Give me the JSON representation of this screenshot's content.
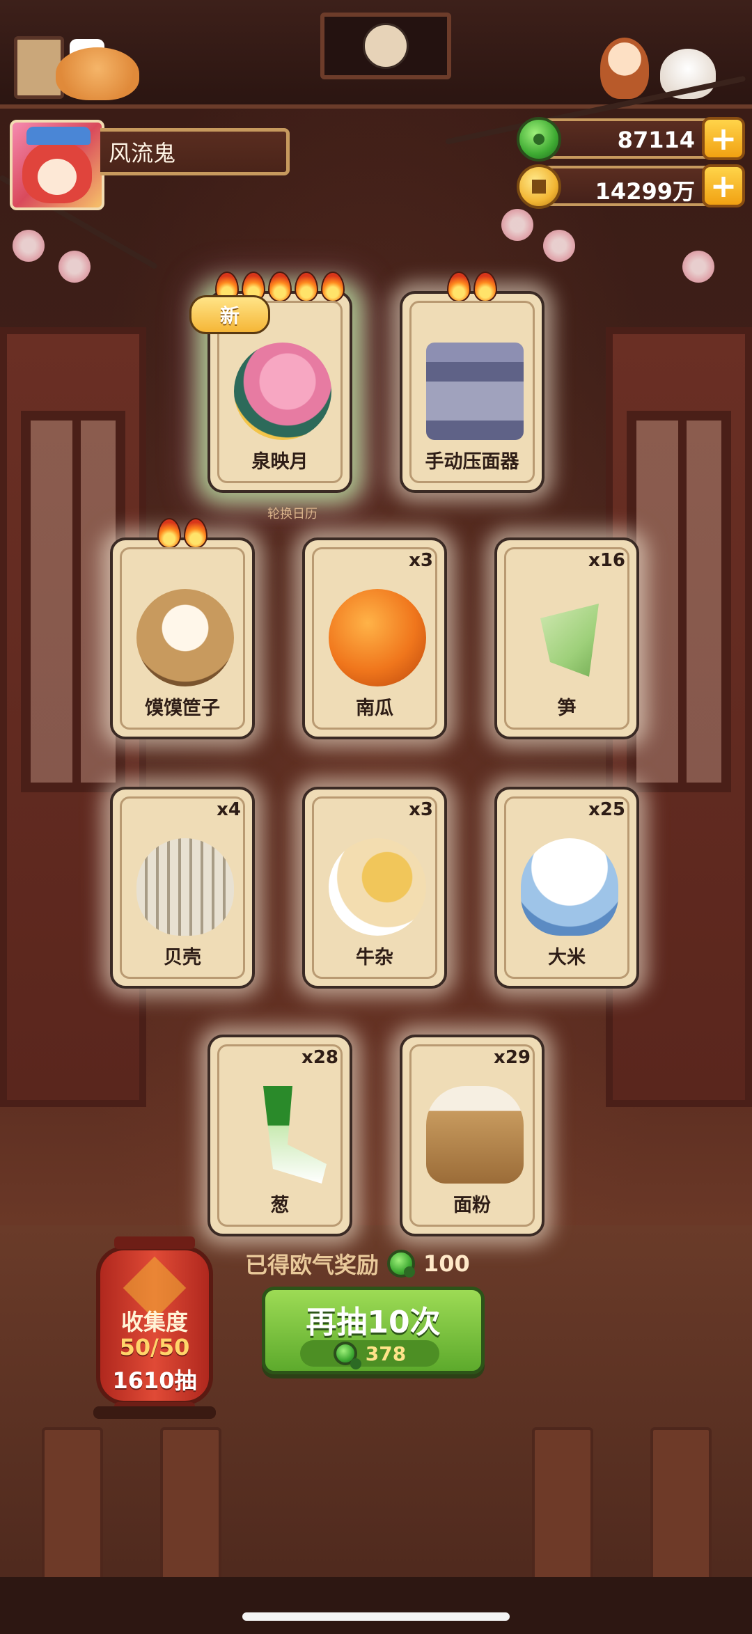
{
  "player": {
    "name": "风流鬼"
  },
  "currencies": {
    "jade": {
      "amount": "87114",
      "icon": "jade-icon"
    },
    "coins": {
      "amount": "14299万",
      "icon": "coin-icon"
    },
    "plus_symbol": "+"
  },
  "cards": [
    {
      "name": "泉映月",
      "count": "",
      "flames": 5,
      "is_new": true,
      "new_label": "新",
      "icon": "fish-cake-icon"
    },
    {
      "name": "手动压面器",
      "count": "",
      "flames": 2,
      "is_new": false,
      "icon": "noodle-press-icon"
    },
    {
      "name": "馍馍笸子",
      "count": "",
      "flames": 2,
      "is_new": false,
      "icon": "steamer-basket-icon"
    },
    {
      "name": "南瓜",
      "count": "x3",
      "flames": 0,
      "is_new": false,
      "icon": "pumpkin-icon"
    },
    {
      "name": "笋",
      "count": "x16",
      "flames": 0,
      "is_new": false,
      "icon": "bamboo-shoot-icon"
    },
    {
      "name": "贝壳",
      "count": "x4",
      "flames": 0,
      "is_new": false,
      "icon": "shell-icon"
    },
    {
      "name": "牛杂",
      "count": "x3",
      "flames": 0,
      "is_new": false,
      "icon": "beef-offal-icon"
    },
    {
      "name": "大米",
      "count": "x25",
      "flames": 0,
      "is_new": false,
      "icon": "rice-bowl-icon"
    },
    {
      "name": "葱",
      "count": "x28",
      "flames": 0,
      "is_new": false,
      "icon": "scallion-icon"
    },
    {
      "name": "面粉",
      "count": "x29",
      "flames": 0,
      "is_new": false,
      "icon": "flour-sack-icon"
    }
  ],
  "sub_caption": "轮换日历",
  "collection": {
    "title": "收集度",
    "progress": "50/50",
    "draws": "1610抽"
  },
  "reward": {
    "label": "已得欧气奖励",
    "amount": "100"
  },
  "draw_button": {
    "label": "再抽10次",
    "cost": "378"
  },
  "colors": {
    "accent_green": "#5daa2c",
    "gold": "#f2b634",
    "card_bg": "#efdcb6"
  }
}
